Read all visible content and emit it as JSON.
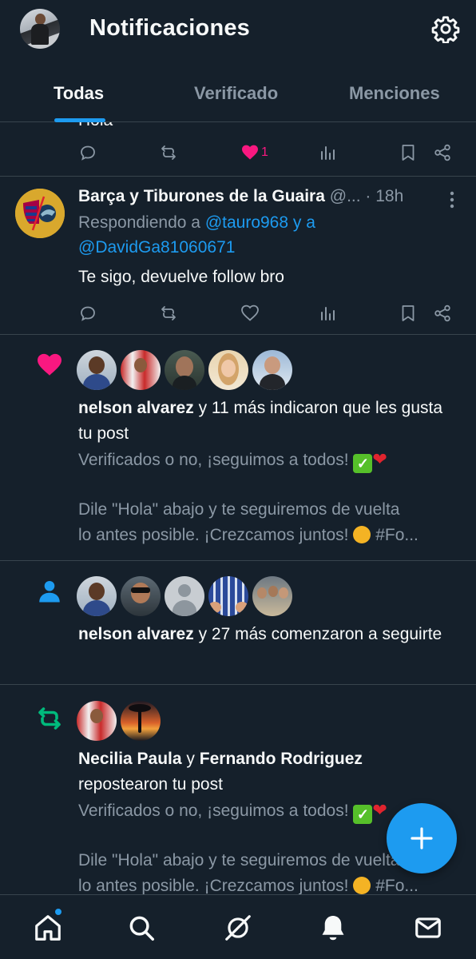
{
  "header": {
    "title": "Notificaciones",
    "tabs": [
      {
        "label": "Todas",
        "active": true
      },
      {
        "label": "Verificado",
        "active": false
      },
      {
        "label": "Menciones",
        "active": false
      }
    ]
  },
  "feed": {
    "partial_tweet": {
      "text_fragment": "Hola",
      "like_count": "1"
    },
    "tweet": {
      "name": "Barça y Tiburones de la Guaira",
      "handle": "@...",
      "time": "· 18h",
      "reply_prefix": "Respondiendo a",
      "reply_user1": "@tauro968",
      "reply_and": "y a",
      "reply_user2": "@DavidGa81060671",
      "text": "Te sigo, devuelve follow bro"
    },
    "likes_notification": {
      "actor": "nelson alvarez",
      "action": "y 11 más indicaron que les gusta tu post",
      "preview_line1": "Verificados o no, ¡seguimos a todos!",
      "preview_line2": "Dile \"Hola\" abajo y te seguiremos de vuelta",
      "preview_line3": "lo antes posible. ¡Crezcamos juntos!",
      "preview_hashtag": "#Fo..."
    },
    "follows_notification": {
      "actor": "nelson alvarez",
      "action": "y 27 más comenzaron a seguirte"
    },
    "repost_notification": {
      "actor1": "Necilia Paula",
      "conj": "y",
      "actor2": "Fernando Rodriguez",
      "action": "repostearon tu post",
      "preview_line1": "Verificados o no, ¡seguimos a todos!",
      "preview_line2": "Dile \"Hola\" abajo y te seguiremos de vuelta",
      "preview_line3": "lo antes posible. ¡Crezcamos juntos!",
      "preview_hashtag": "#Fo..."
    }
  },
  "icons": {
    "settings": "gear-icon",
    "reply": "reply-icon",
    "repost": "repost-icon",
    "like": "heart-icon",
    "views": "views-icon",
    "bookmark": "bookmark-icon",
    "share": "share-icon",
    "compose": "plus-icon",
    "nav": [
      "home-icon",
      "search-icon",
      "grok-icon",
      "bell-icon",
      "mail-icon"
    ]
  },
  "colors": {
    "background": "#15202b",
    "accent": "#1d9bf0",
    "like": "#f91880",
    "repost": "#00ba7c",
    "muted": "#8b98a5",
    "divider": "#38444d"
  }
}
